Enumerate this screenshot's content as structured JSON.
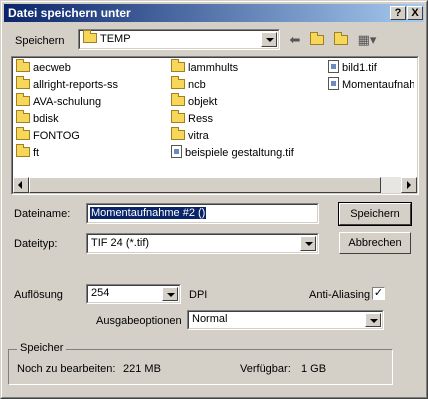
{
  "window": {
    "title": "Datei speichern unter",
    "help_btn": "?",
    "close_btn": "X"
  },
  "savein": {
    "label": "Speichern",
    "value": "TEMP"
  },
  "toolbar": {
    "back_icon": "back-arrow-icon",
    "up_icon": "up-folder-icon",
    "new_folder_icon": "new-folder-icon",
    "view_icon": "view-menu-icon"
  },
  "files": [
    {
      "name": "aecweb",
      "type": "folder"
    },
    {
      "name": "allright-reports-ss",
      "type": "folder"
    },
    {
      "name": "AVA-schulung",
      "type": "folder"
    },
    {
      "name": "bdisk",
      "type": "folder"
    },
    {
      "name": "FONTOG",
      "type": "folder"
    },
    {
      "name": "ft",
      "type": "folder"
    },
    {
      "name": "lammhults",
      "type": "folder"
    },
    {
      "name": "ncb",
      "type": "folder"
    },
    {
      "name": "objekt",
      "type": "folder"
    },
    {
      "name": "Ress",
      "type": "folder"
    },
    {
      "name": "vitra",
      "type": "folder"
    },
    {
      "name": "beispiele gestaltung.tif",
      "type": "file"
    },
    {
      "name": "bild1.tif",
      "type": "file"
    },
    {
      "name": "Momentaufnahm",
      "type": "file"
    }
  ],
  "filename": {
    "label": "Dateiname:",
    "value": "Momentaufnahme #2 ()"
  },
  "filetype": {
    "label": "Dateityp:",
    "value": "TIF 24 (*.tif)"
  },
  "buttons": {
    "save": "Speichern",
    "cancel": "Abbrechen"
  },
  "resolution": {
    "label": "Auflösung",
    "value": "254",
    "unit": "DPI"
  },
  "antialias": {
    "label": "Anti-Aliasing",
    "checked": "✓"
  },
  "output": {
    "label": "Ausgabeoptionen",
    "value": "Normal"
  },
  "memory": {
    "group_label": "Speicher",
    "remaining_label": "Noch zu bearbeiten:",
    "remaining_value": "221 MB",
    "available_label": "Verfügbar:",
    "available_value": "1 GB"
  }
}
